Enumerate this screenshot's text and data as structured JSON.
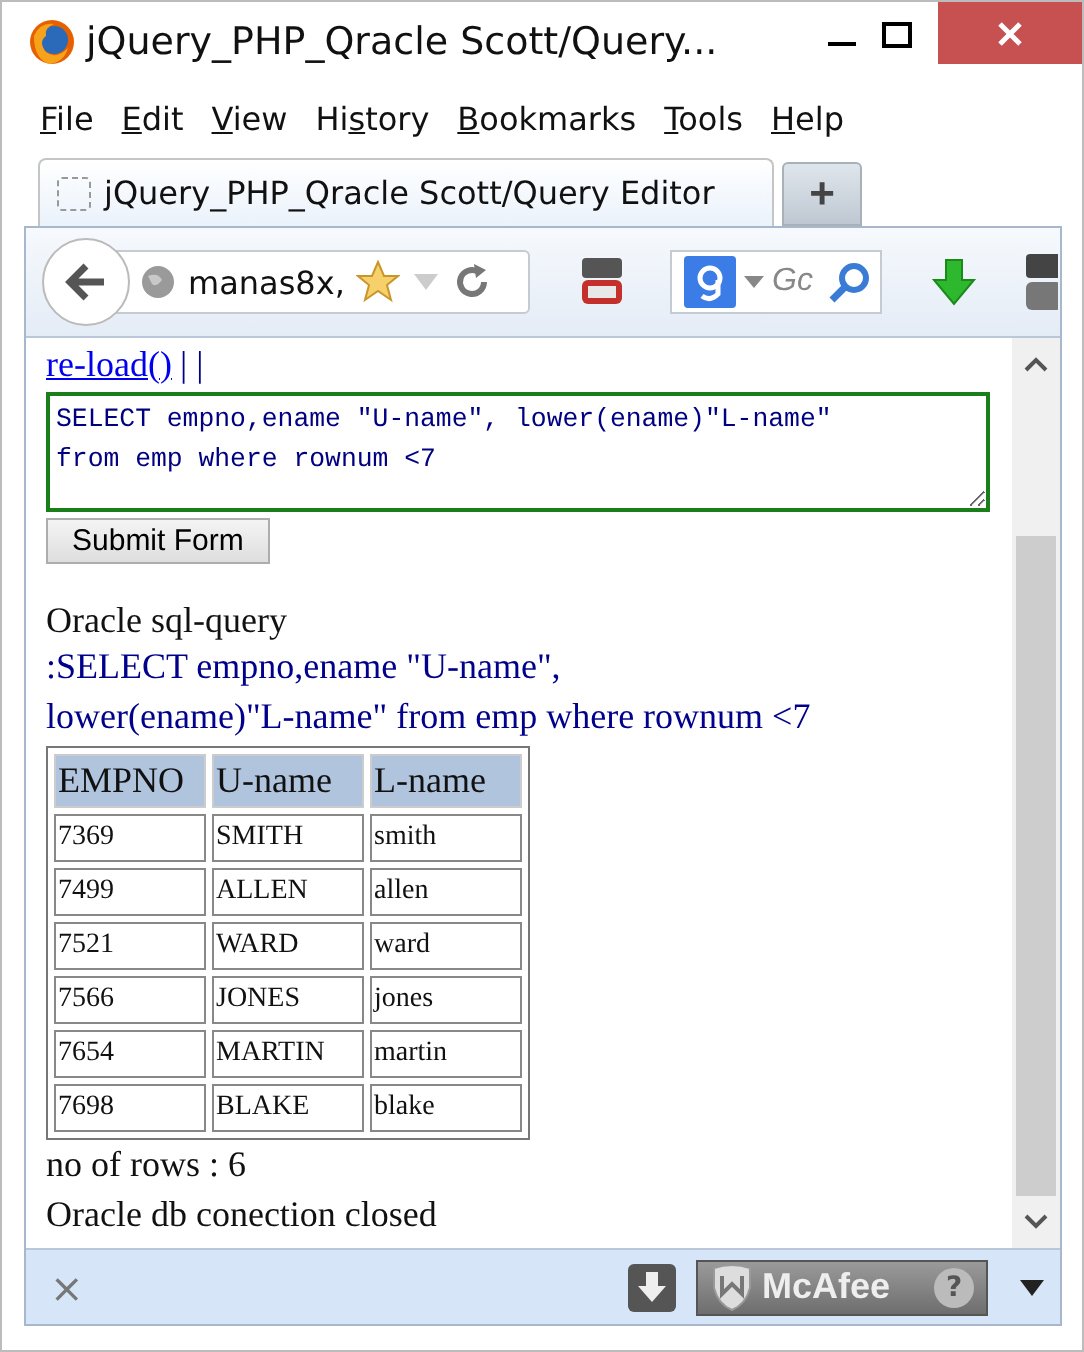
{
  "window": {
    "title": "jQuery_PHP_Qracle Scott/Query..."
  },
  "menu": [
    {
      "key": "F",
      "after": "ile"
    },
    {
      "key": "E",
      "after": "dit"
    },
    {
      "key": "V",
      "after": "iew"
    },
    {
      "before": "Hi",
      "key": "s",
      "after": "tory"
    },
    {
      "key": "B",
      "after": "ookmarks"
    },
    {
      "key": "T",
      "after": "ools"
    },
    {
      "key": "H",
      "after": "elp"
    }
  ],
  "tabs": [
    {
      "label": "jQuery_PHP_Qracle Scott/Query Editor",
      "selected": true
    }
  ],
  "new_tab": "+",
  "toolbar": {
    "address": "manas8x,",
    "search_placeholder": "Gc"
  },
  "page": {
    "link": "re-load()",
    "separator": "| |",
    "query_input": "SELECT empno,ename \"U-name\", lower(ename)\"L-name\"\nfrom emp where rownum <7",
    "submit": "Submit Form",
    "heading": "Oracle sql-query",
    "query_echo": ":SELECT empno,ename \"U-name\",\nlower(ename)\"L-name\" from emp where rownum <7",
    "table": {
      "columns": [
        "EMPNO",
        "U-name",
        "L-name"
      ],
      "rows": [
        [
          "7369",
          "SMITH",
          "smith"
        ],
        [
          "7499",
          "ALLEN",
          "allen"
        ],
        [
          "7521",
          "WARD",
          "ward"
        ],
        [
          "7566",
          "JONES",
          "jones"
        ],
        [
          "7654",
          "MARTIN",
          "martin"
        ],
        [
          "7698",
          "BLAKE",
          "blake"
        ]
      ]
    },
    "row_count": "no of rows : 6",
    "status": "Oracle db conection closed"
  },
  "bottom_bar": {
    "close": "×",
    "addon": "McAfee",
    "help": "?"
  }
}
